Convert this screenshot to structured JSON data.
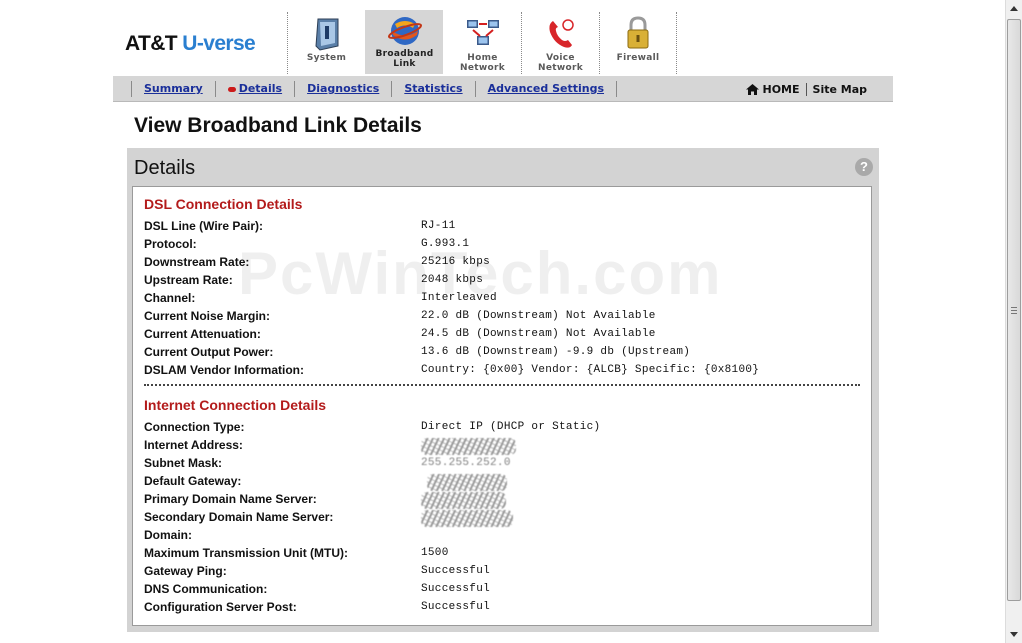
{
  "header": {
    "logo_att": "AT&T",
    "logo_uverse": "U-verse"
  },
  "nav": {
    "tabs": [
      {
        "label_line1": "System",
        "label_line2": "",
        "icon": "system-icon"
      },
      {
        "label_line1": "Broadband",
        "label_line2": "Link",
        "icon": "broadband-globe-icon",
        "active": true
      },
      {
        "label_line1": "Home",
        "label_line2": "Network",
        "icon": "home-network-icon"
      },
      {
        "label_line1": "Voice",
        "label_line2": "Network",
        "icon": "telephone-icon"
      },
      {
        "label_line1": "Firewall",
        "label_line2": "",
        "icon": "padlock-icon"
      }
    ]
  },
  "subnav": {
    "links": [
      "Summary",
      "Details",
      "Diagnostics",
      "Statistics",
      "Advanced Settings"
    ],
    "active": "Details",
    "home": "HOME",
    "sitemap": "Site Map"
  },
  "page_title": "View Broadband Link Details",
  "panel": {
    "title": "Details",
    "help": "?"
  },
  "watermark": "PcWinTech.com",
  "dsl": {
    "title": "DSL Connection Details",
    "rows": [
      {
        "key": "DSL Line (Wire Pair):",
        "value": "RJ-11"
      },
      {
        "key": "Protocol:",
        "value": "G.993.1"
      },
      {
        "key": "Downstream Rate:",
        "value": "25216 kbps"
      },
      {
        "key": "Upstream Rate:",
        "value": "2048 kbps"
      },
      {
        "key": "Channel:",
        "value": "Interleaved"
      },
      {
        "key": "Current Noise Margin:",
        "value": "22.0 dB (Downstream) Not Available"
      },
      {
        "key": "Current Attenuation:",
        "value": "24.5 dB (Downstream) Not Available"
      },
      {
        "key": "Current Output Power:",
        "value": "13.6 dB (Downstream) -9.9 db (Upstream)"
      },
      {
        "key": "DSLAM Vendor Information:",
        "value": "Country: {0x00} Vendor: {ALCB} Specific: {0x8100}"
      }
    ]
  },
  "internet": {
    "title": "Internet Connection Details",
    "rows": [
      {
        "key": "Connection Type:",
        "value": "Direct IP (DHCP or Static)"
      },
      {
        "key": "Internet Address:",
        "value": ""
      },
      {
        "key": "Subnet Mask:",
        "value": "255.255.252.0"
      },
      {
        "key": "Default Gateway:",
        "value": ""
      },
      {
        "key": "Primary Domain Name Server:",
        "value": ""
      },
      {
        "key": "Secondary Domain Name Server:",
        "value": ""
      },
      {
        "key": "Domain:",
        "value": ""
      },
      {
        "key": "Maximum Transmission Unit (MTU):",
        "value": "1500"
      },
      {
        "key": "Gateway Ping:",
        "value": "Successful"
      },
      {
        "key": "DNS Communication:",
        "value": "Successful"
      },
      {
        "key": "Configuration Server Post:",
        "value": "Successful"
      }
    ]
  },
  "colors": {
    "section_title": "#b31b1b",
    "link": "#1a2f9a",
    "logo_accent": "#2a7fd0",
    "panel_bg": "#d3d3d3"
  }
}
